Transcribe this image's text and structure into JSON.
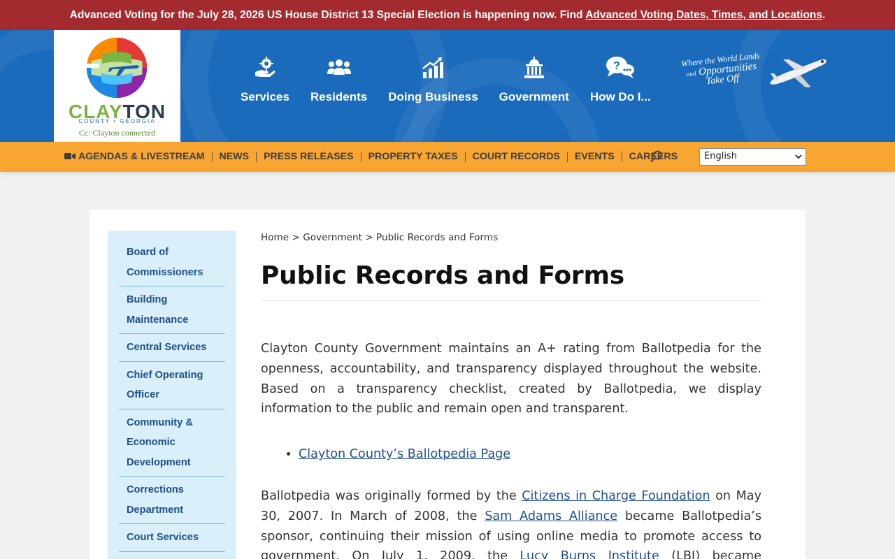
{
  "alert": {
    "text": "Advanced Voting for the July 28, 2026 US House District 13 Special Election is happening now. Find ",
    "link": "Advanced Voting Dates, Times, and Locations",
    "suffix": "."
  },
  "logo": {
    "word_a": "CLAY",
    "word_b": "TON",
    "sub": "COUNTY • GEORGIA",
    "tagline": "Cc: Clayton connected"
  },
  "main_nav": [
    {
      "label": "Services",
      "icon": "gear-hand-icon"
    },
    {
      "label": "Residents",
      "icon": "people-group-icon"
    },
    {
      "label": "Doing Business",
      "icon": "growth-chart-icon"
    },
    {
      "label": "Government",
      "icon": "capitol-building-icon"
    },
    {
      "label": "How Do I...",
      "icon": "question-bubbles-icon"
    }
  ],
  "header_tagline": {
    "line1": "Where the World Lands",
    "line2_small": "and",
    "line2": "Opportunities",
    "line3": "Take Off"
  },
  "util_nav": [
    {
      "label": "AGENDAS & LIVESTREAM",
      "icon": "video-camera-icon"
    },
    {
      "label": "NEWS"
    },
    {
      "label": "PRESS RELEASES"
    },
    {
      "label": "PROPERTY TAXES"
    },
    {
      "label": "COURT RECORDS"
    },
    {
      "label": "EVENTS"
    },
    {
      "label": "CAREERS"
    }
  ],
  "language": {
    "selected": "English"
  },
  "sidebar": [
    "Board of Commissioners",
    "Building Maintenance",
    "Central Services",
    "Chief Operating Officer",
    "Community & Economic Development",
    "Corrections Department",
    "Court Services"
  ],
  "breadcrumb": {
    "home": "Home",
    "sep": ">",
    "section": "Government",
    "current": "Public Records and Forms"
  },
  "page_title": "Public Records and Forms",
  "body": {
    "p1": "Clayton County Government maintains an A+ rating from Ballotpedia for the openness, accountability, and transparency displayed throughout the website. Based on a transparency checklist, created by Ballotpedia, we display information to the public and remain open and transparent.",
    "bullet1": "Clayton County’s Ballotpedia Page",
    "p2_a": "Ballotpedia was originally formed by the ",
    "p2_link1": "Citizens in Charge Foundation",
    "p2_b": " on May 30, 2007. In March of 2008, the ",
    "p2_link2": "Sam Adams Alliance",
    "p2_c": " became Ballotpedia’s sponsor, continuing their mission of using online media to promote access to government. On July 1, 2009, the ",
    "p2_link3": "Lucy Burns Institute",
    "p2_d": " (LBI) became Ballotpedia’s official sponsor."
  },
  "colors": {
    "alert_bg": "#a32a2f",
    "header_bg": "#1b6bbd",
    "util_nav_bg": "#f9a531",
    "sidebar_bg": "#d9effa",
    "link": "#1d4f8d"
  }
}
